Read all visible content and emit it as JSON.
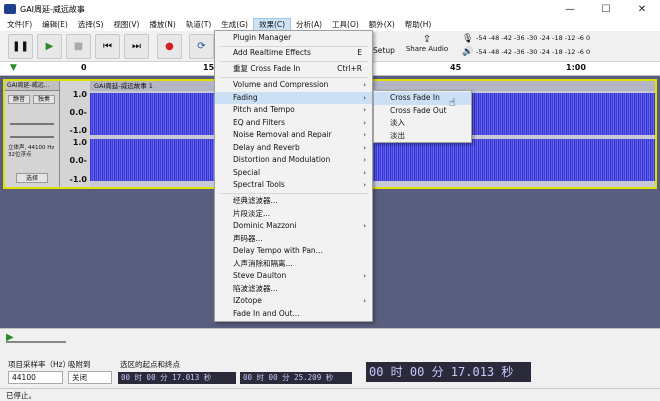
{
  "window": {
    "title": "GAI周延-威远故事",
    "minimize": "—",
    "maximize": "☐",
    "close": "✕"
  },
  "menubar": [
    "文件(F)",
    "编辑(E)",
    "选择(S)",
    "视图(V)",
    "播放(N)",
    "轨道(T)",
    "生成(G)",
    "效果(C)",
    "分析(A)",
    "工具(O)",
    "额外(X)",
    "帮助(H)"
  ],
  "toolbar": {
    "setup_label": "Setup",
    "share_label": "Share Audio",
    "meter_l_ticks": "-54 -48 -42 -36 -30 -24 -18 -12 -6 0",
    "meter_r_ticks": "-54 -48 -42 -36 -30 -24 -18 -12 -6 0"
  },
  "ruler": {
    "ticks": [
      "0",
      "15",
      "45",
      "1:00"
    ]
  },
  "track": {
    "name": "GAI周延-威远...",
    "mute": "静音",
    "solo": "独奏",
    "info": "立体声, 44100 Hz\n32位浮点",
    "select": "选择",
    "clip_name": "GAI周延-威远故事 1",
    "scale": [
      "1.0",
      "0.0-",
      "-1.0",
      "1.0",
      "0.0-",
      "-1.0"
    ]
  },
  "effects_menu": [
    {
      "label": "Plugin Manager"
    },
    {
      "label": "Add Realtime Effects",
      "shortcut": "E"
    },
    {
      "label": "重复 Cross Fade In",
      "shortcut": "Ctrl+R"
    },
    {
      "label": "Volume and Compression"
    },
    {
      "label": "Fading"
    },
    {
      "label": "Pitch and Tempo"
    },
    {
      "label": "EQ and Filters"
    },
    {
      "label": "Noise Removal and Repair"
    },
    {
      "label": "Delay and Reverb"
    },
    {
      "label": "Distortion and Modulation"
    },
    {
      "label": "Special"
    },
    {
      "label": "Spectral Tools"
    },
    {
      "label": "经典滤波器..."
    },
    {
      "label": "片段淡定..."
    },
    {
      "label": "Dominic Mazzoni"
    },
    {
      "label": "声码器..."
    },
    {
      "label": "Delay Tempo with Pan..."
    },
    {
      "label": "人声消除和隔离..."
    },
    {
      "label": "Steve Daulton"
    },
    {
      "label": "陷波滤波器..."
    },
    {
      "label": "IZotope"
    },
    {
      "label": "Fade In and Out..."
    }
  ],
  "fading_submenu": [
    "Cross Fade In",
    "Cross Fade Out",
    "淡入",
    "淡出"
  ],
  "bottom": {
    "rate_label": "项目采样率（Hz）",
    "snap_label": "吸附到",
    "rate_value": "44100",
    "snap_value": "关闭",
    "selection_label": "选区的起点和终点",
    "sel_start": "00 时 00 分 17.013 秒",
    "sel_end": "00 时 00 分 25.209 秒",
    "big_time": "00 时 00 分 17.013 秒"
  },
  "status": "已停止。",
  "colors": {
    "accent": "#cce0f5",
    "wave": "#3c3cd8",
    "track_bg": "#5a5e7e",
    "selection_border": "#e0e000"
  }
}
